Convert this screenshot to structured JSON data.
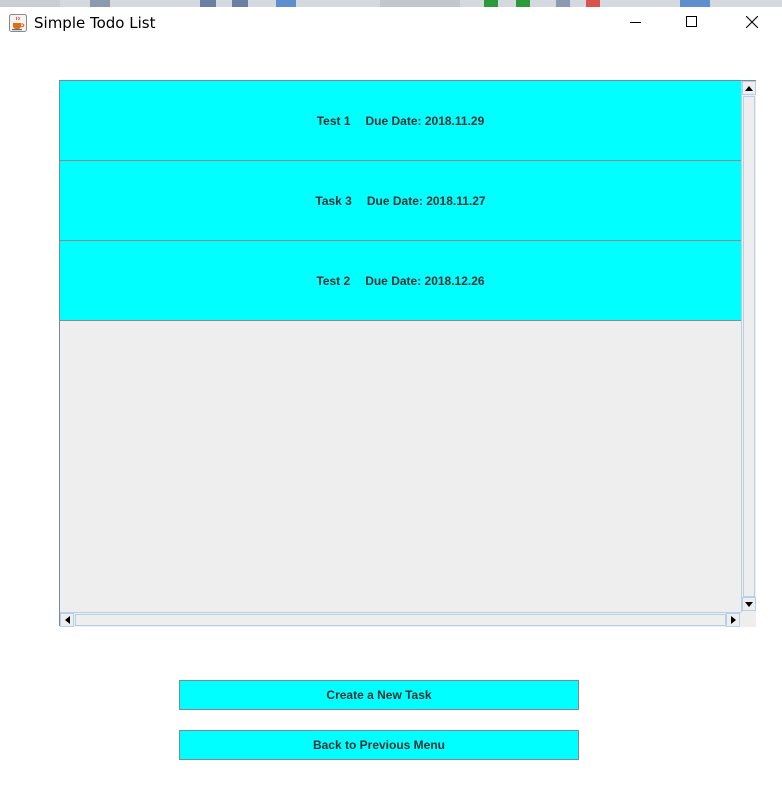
{
  "window": {
    "title": "Simple Todo List",
    "icon": "java-cup-icon",
    "controls": [
      "minimize-icon",
      "maximize-icon",
      "close-icon"
    ]
  },
  "todo_list": {
    "items": [
      {
        "name": "Test 1",
        "due": "Due Date: 2018.11.29"
      },
      {
        "name": "Task 3",
        "due": "Due Date: 2018.11.27"
      },
      {
        "name": "Test 2",
        "due": "Due Date: 2018.12.26"
      }
    ]
  },
  "buttons": {
    "create_label": "Create a New Task",
    "back_label": "Back to Previous Menu"
  },
  "colors": {
    "item_background": "#00ffff",
    "button_background": "#00ffff",
    "list_background": "#eeeeee"
  }
}
